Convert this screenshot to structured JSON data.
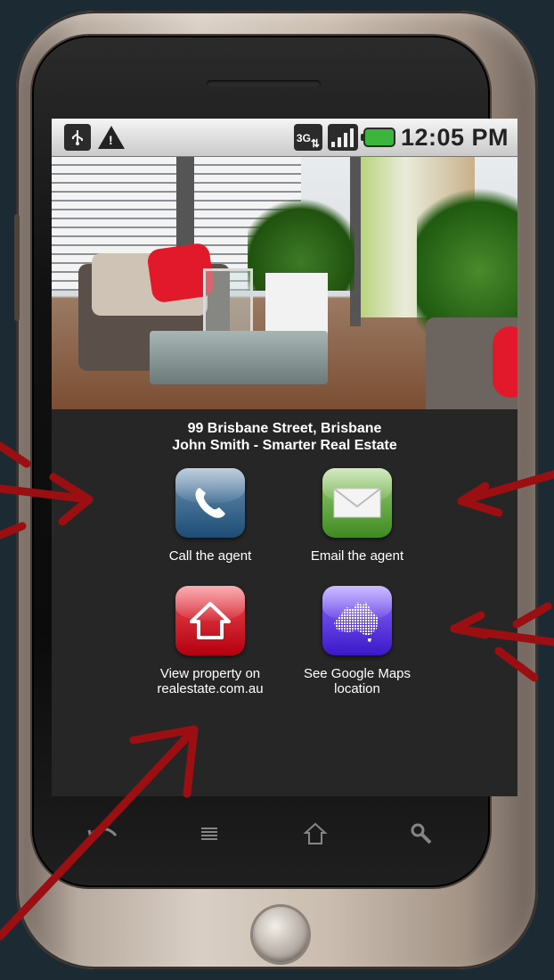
{
  "status_bar": {
    "icons": [
      "usb-icon",
      "warning-icon",
      "3g-data-icon",
      "signal-icon",
      "battery-icon"
    ],
    "network_label": "3G",
    "time": "12:05 PM",
    "battery_color": "#3bb53b"
  },
  "listing": {
    "address": "99 Brisbane Street, Brisbane",
    "agent_line": "John Smith - Smarter Real Estate"
  },
  "actions": {
    "call": {
      "label": "Call the agent",
      "icon": "phone-icon"
    },
    "email": {
      "label": "Email the agent",
      "icon": "envelope-icon"
    },
    "view": {
      "label_line1": "View property on",
      "label_line2": "realestate.com.au",
      "icon": "house-icon"
    },
    "map": {
      "label_line1": "See Google Maps",
      "label_line2": "location",
      "icon": "australia-map-icon"
    }
  },
  "navigation": [
    "back-icon",
    "menu-icon",
    "home-icon",
    "search-icon"
  ],
  "annotation_color": "#9b0f12"
}
